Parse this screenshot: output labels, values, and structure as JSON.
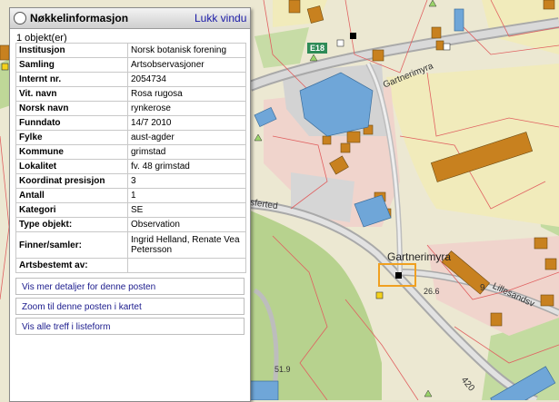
{
  "panel": {
    "title": "Nøkkelinformasjon",
    "close_label": "Lukk vindu",
    "count_text": "1 objekt(er)",
    "rows": [
      {
        "key": "Institusjon",
        "value": "Norsk botanisk forening"
      },
      {
        "key": "Samling",
        "value": "Artsobservasjoner"
      },
      {
        "key": "Internt nr.",
        "value": "2054734"
      },
      {
        "key": "Vit. navn",
        "value": "Rosa rugosa"
      },
      {
        "key": "Norsk navn",
        "value": "rynkerose"
      },
      {
        "key": "Funndato",
        "value": "14/7 2010"
      },
      {
        "key": "Fylke",
        "value": "aust-agder"
      },
      {
        "key": "Kommune",
        "value": "grimstad"
      },
      {
        "key": "Lokalitet",
        "value": "fv. 48 grimstad"
      },
      {
        "key": "Koordinat presisjon",
        "value": "3"
      },
      {
        "key": "Antall",
        "value": "1"
      },
      {
        "key": "Kategori",
        "value": "SE"
      },
      {
        "key": "Type objekt:",
        "value": "Observation"
      },
      {
        "key": "Finner/samler:",
        "value": "Ingrid Helland, Renate Vea Petersson"
      },
      {
        "key": "Artsbestemt av:",
        "value": ""
      }
    ],
    "actions": {
      "details": "Vis mer detaljer for denne posten",
      "zoom": "Zoom til denne posten i kartet",
      "list": "Vis alle treff i listeform"
    }
  },
  "map": {
    "labels": {
      "road_e18": "E18",
      "gartnerimyra_road": "Gartnerimyra",
      "gartnerimyra_place": "Gartnerimyra",
      "lillesandsveien": "Lillesandsv",
      "road_420": "420",
      "road_9": "9",
      "elev_26": "26.6",
      "elev_51": "51.9",
      "sferted": "sferted"
    },
    "colors": {
      "building": "#c8811f",
      "large_building": "#6fa6d8",
      "road": "#a9a9a9",
      "property_line": "#e06060",
      "forest": "#b9d48f",
      "field": "#efe9b9"
    }
  }
}
